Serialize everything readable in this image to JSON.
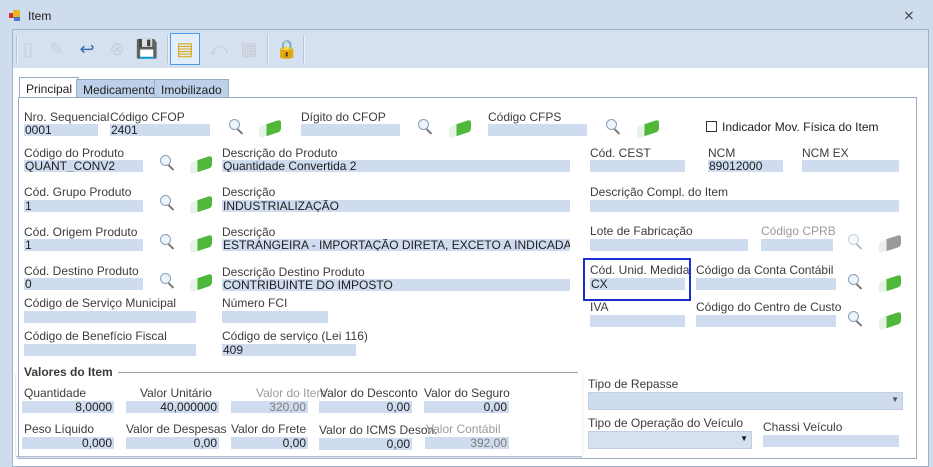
{
  "window": {
    "title": "Item",
    "close": "⨯"
  },
  "tabs": [
    "Principal",
    "Medicamento",
    "Imobilizado"
  ],
  "fields": {
    "nro_seq": {
      "label": "Nro. Sequencial",
      "value": "0001"
    },
    "cfop": {
      "label": "Código CFOP",
      "value": "2401"
    },
    "dig_cfop": {
      "label": "Dígito do CFOP",
      "value": ""
    },
    "cfps": {
      "label": "Código CFPS",
      "value": ""
    },
    "mov_fisica": {
      "label": "Indicador Mov. Física do Item",
      "checked": false
    },
    "cod_prod": {
      "label": "Código do Produto",
      "value": "QUANT_CONV2"
    },
    "desc_prod": {
      "label": "Descrição do Produto",
      "value": "Quantidade Convertida 2"
    },
    "cest": {
      "label": "Cód. CEST",
      "value": ""
    },
    "ncm": {
      "label": "NCM",
      "value": "89012000"
    },
    "ncm_ex": {
      "label": "NCM EX",
      "value": ""
    },
    "grupo": {
      "label": "Cód. Grupo Produto",
      "value": "1"
    },
    "grupo_desc": {
      "label": "Descrição",
      "value": "INDUSTRIALIZAÇÃO"
    },
    "desc_compl": {
      "label": "Descrição Compl. do Item",
      "value": ""
    },
    "origem": {
      "label": "Cód. Origem Produto",
      "value": "1"
    },
    "origem_desc": {
      "label": "Descrição",
      "value": "ESTRANGEIRA - IMPORTAÇÃO DIRETA, EXCETO A INDICADA NO CÓ"
    },
    "lote": {
      "label": "Lote de Fabricação",
      "value": ""
    },
    "cprb": {
      "label": "Código CPRB",
      "value": ""
    },
    "destino": {
      "label": "Cód. Destino Produto",
      "value": "0"
    },
    "destino_desc": {
      "label": "Descrição Destino Produto",
      "value": "CONTRIBUINTE DO IMPOSTO"
    },
    "unid": {
      "label": "Cód. Unid. Medida",
      "value": "CX"
    },
    "conta": {
      "label": "Código da Conta Contábil",
      "value": ""
    },
    "serv_mun": {
      "label": "Código de Serviço Municipal",
      "value": ""
    },
    "fci": {
      "label": "Número FCI",
      "value": ""
    },
    "iva": {
      "label": "IVA",
      "value": ""
    },
    "centro": {
      "label": "Código do Centro de Custo",
      "value": ""
    },
    "benef": {
      "label": "Código de Benefício Fiscal",
      "value": ""
    },
    "serv116": {
      "label": "Código de serviço (Lei 116)",
      "value": "409"
    }
  },
  "valores": {
    "title": "Valores do Item",
    "quantidade": {
      "label": "Quantidade",
      "value": "8,0000"
    },
    "unitario": {
      "label": "Valor Unitário",
      "value": "40,000000"
    },
    "item": {
      "label": "Valor do Item",
      "value": "320,00"
    },
    "desconto": {
      "label": "Valor do Desconto",
      "value": "0,00"
    },
    "seguro": {
      "label": "Valor do Seguro",
      "value": "0,00"
    },
    "peso": {
      "label": "Peso Líquido",
      "value": "0,000"
    },
    "despesas": {
      "label": "Valor de Despesas",
      "value": "0,00"
    },
    "frete": {
      "label": "Valor do  Frete",
      "value": "0,00"
    },
    "icms_deson": {
      "label": "Valor do ICMS Deson.",
      "value": "0,00"
    },
    "contabil": {
      "label": "Valor Contábil",
      "value": "392,00"
    }
  },
  "right": {
    "repasse": {
      "label": "Tipo de Repasse",
      "value": ""
    },
    "tipo_op": {
      "label": "Tipo de Operação do Veículo",
      "value": ""
    },
    "chassi": {
      "label": "Chassi Veículo",
      "value": ""
    }
  }
}
